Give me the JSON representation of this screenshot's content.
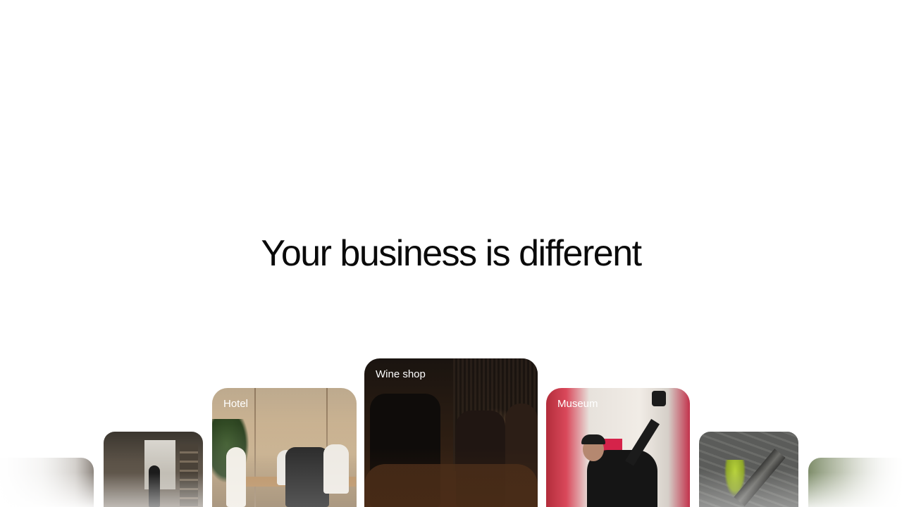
{
  "hero": {
    "headline": "Your business is different"
  },
  "carousel": {
    "cards": [
      {
        "label": ""
      },
      {
        "label": ""
      },
      {
        "label": "Hotel"
      },
      {
        "label": "Wine shop"
      },
      {
        "label": "Museum"
      },
      {
        "label": ""
      },
      {
        "label": ""
      }
    ]
  },
  "colors": {
    "background": "#ffffff",
    "headline": "#0a0a0a",
    "card_label": "#ffffff"
  }
}
